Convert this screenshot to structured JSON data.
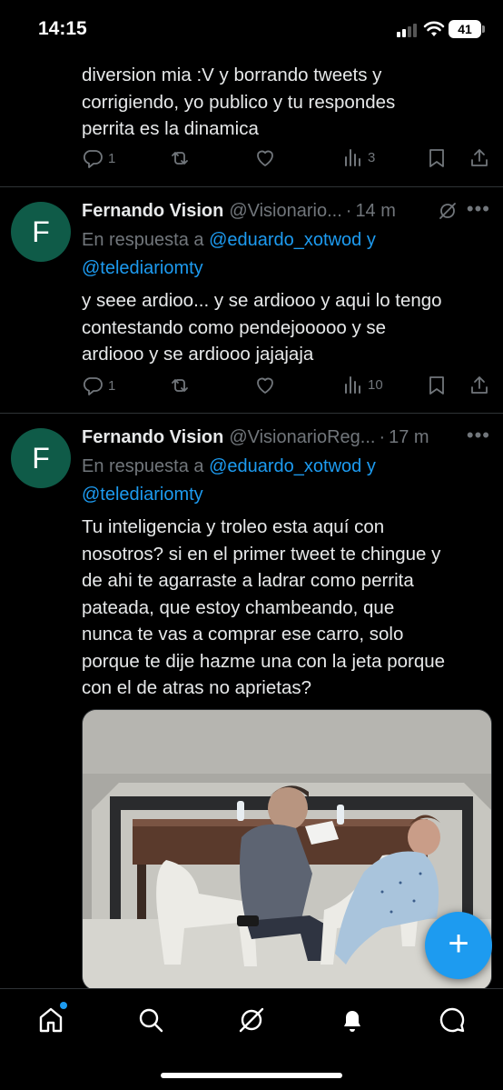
{
  "status_bar": {
    "time": "14:15",
    "battery": "41"
  },
  "tweets": [
    {
      "text_lines": [
        "diversion mia :V  y borrando tweets y",
        "corrigiendo, yo publico y tu respondes",
        "perrita es la dinamica"
      ],
      "replies": "1",
      "retweets": "",
      "views": "3"
    },
    {
      "avatar_letter": "F",
      "name": "Fernando Vision",
      "handle": "@Visionario...",
      "time": "14 m",
      "reply_prefix": "En respuesta a",
      "mention_1": "@eduardo_xotwod",
      "conjunction": "y",
      "mention_2": "@telediariomty",
      "text_lines": [
        "y seee ardioo... y se ardiooo y aqui lo tengo",
        "contestando como pendejooooo y se",
        "ardiooo y se ardiooo jajajaja"
      ],
      "replies": "1",
      "views": "10"
    },
    {
      "avatar_letter": "F",
      "name": "Fernando Vision",
      "handle": "@VisionarioReg...",
      "time": "17 m",
      "reply_prefix": "En respuesta a",
      "mention_1": "@eduardo_xotwod",
      "conjunction": "y",
      "mention_2": "@telediariomty",
      "text_lines": [
        "Tu inteligencia y troleo esta aquí con",
        "nosotros? si en el primer tweet te chingue y",
        "de ahi te agarraste a ladrar como perrita",
        "pateada, que estoy chambeando, que",
        "nunca te vas a comprar ese carro, solo",
        "porque te dije hazme una con la jeta porque",
        "con el de atras no aprietas?"
      ]
    }
  ],
  "icons": {
    "reply": "reply-icon",
    "retweet": "retweet-icon",
    "like": "heart-icon",
    "views": "views-icon",
    "bookmark": "bookmark-icon",
    "share": "share-icon",
    "grok": "grok-icon",
    "more": "more-icon",
    "compose": "compose-icon",
    "nav": [
      "home-icon",
      "search-icon",
      "grok-icon",
      "notifications-icon",
      "messages-icon"
    ]
  },
  "colors": {
    "background": "#000000",
    "accent": "#1d9bf0",
    "avatar": "#0f5b48",
    "muted": "#71767b",
    "text": "#e7e9ea"
  }
}
